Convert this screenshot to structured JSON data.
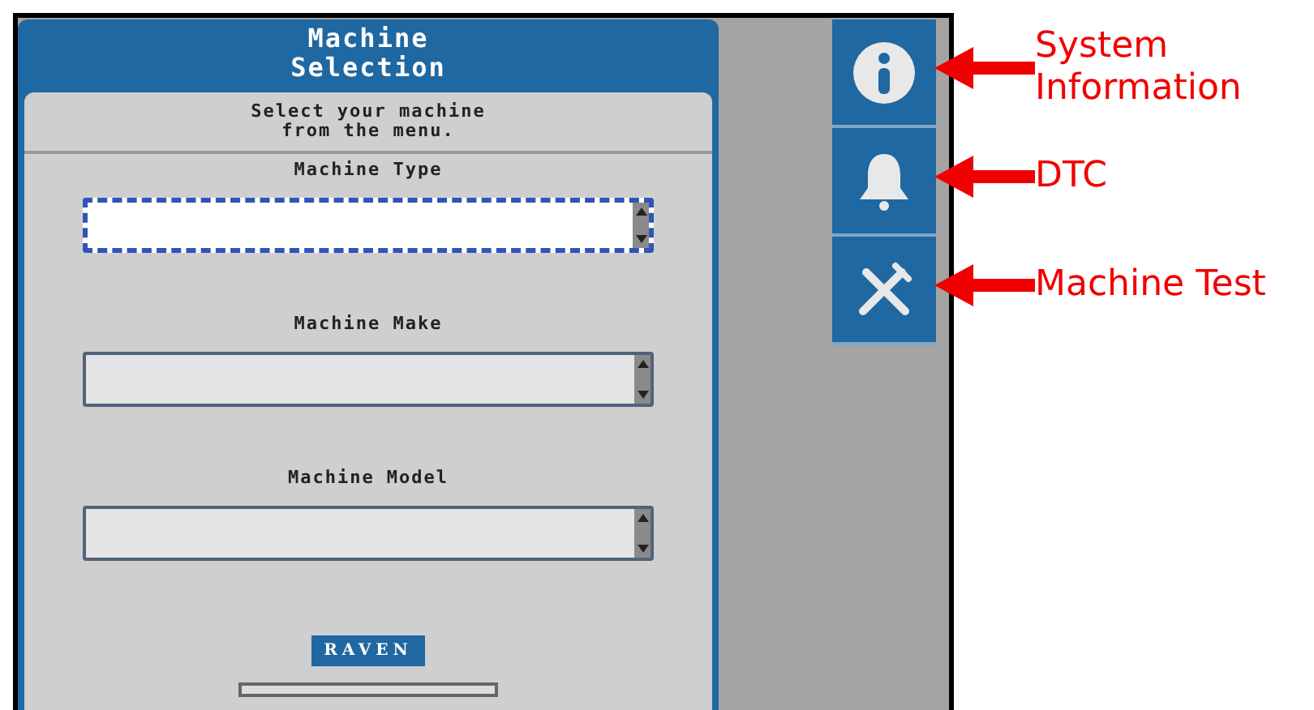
{
  "panel": {
    "title_lines": [
      "Machine",
      "Selection"
    ],
    "instruction_lines": [
      "Select your machine",
      "from the menu."
    ],
    "fields": [
      {
        "label": "Machine Type",
        "focused": true
      },
      {
        "label": "Machine Make",
        "focused": false
      },
      {
        "label": "Machine Model",
        "focused": false
      }
    ],
    "logo": "RAVEN"
  },
  "side_buttons": [
    {
      "kind": "info"
    },
    {
      "kind": "bell"
    },
    {
      "kind": "tools"
    }
  ],
  "annotations": [
    {
      "lines": [
        "System",
        "Information"
      ]
    },
    {
      "lines": [
        "DTC"
      ]
    },
    {
      "lines": [
        "Machine Test"
      ]
    }
  ]
}
